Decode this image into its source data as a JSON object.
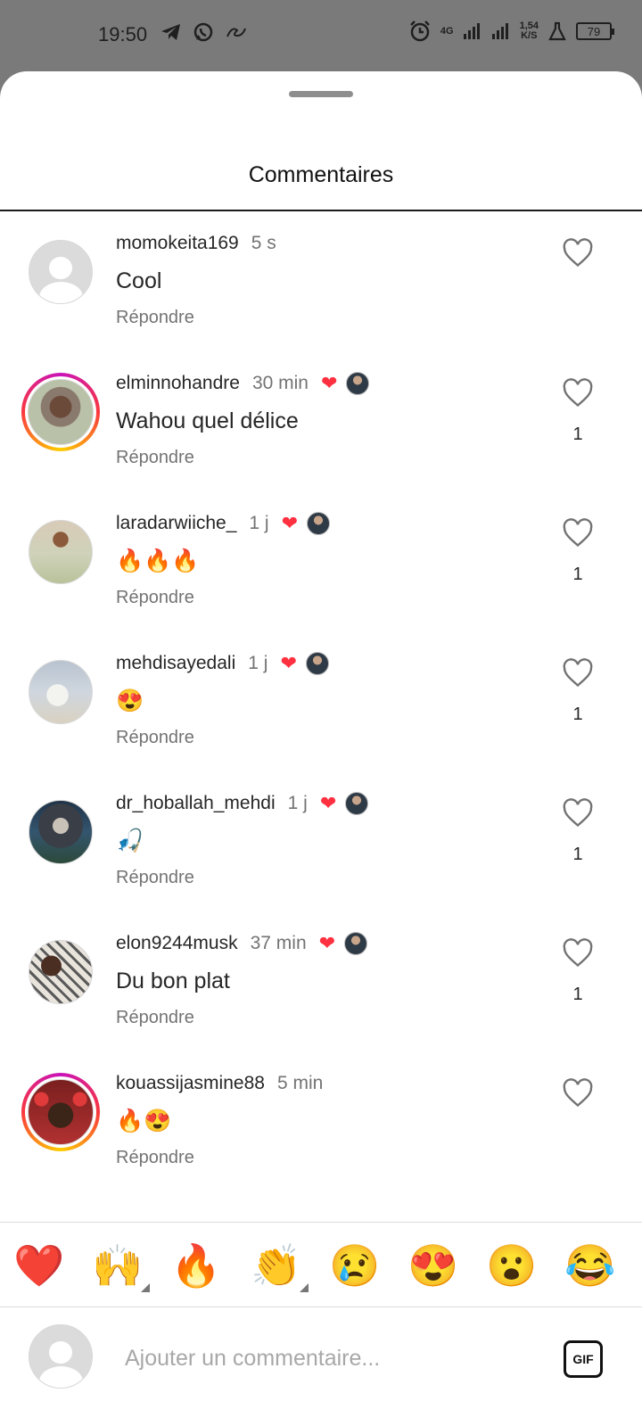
{
  "status_bar": {
    "time": "19:50",
    "network": "4G",
    "speed_value": "1,54",
    "speed_unit": "K/S",
    "battery": "79",
    "icons": [
      "telegram-icon",
      "whatsapp-icon",
      "link-icon",
      "alarm-icon",
      "signal-icon",
      "signal-icon",
      "lab-icon",
      "battery-icon"
    ]
  },
  "sheet": {
    "title": "Commentaires"
  },
  "comments": [
    {
      "username": "momokeita169",
      "time": "5 s",
      "text": "Cool",
      "reply": "Répondre",
      "liked_by_author": false,
      "likes": "",
      "story": false,
      "avatar": "default"
    },
    {
      "username": "elminnohandre",
      "time": "30 min",
      "text": "Wahou quel délice",
      "reply": "Répondre",
      "liked_by_author": true,
      "likes": "1",
      "story": true,
      "avatar": "photo-man"
    },
    {
      "username": "laradarwiiche_",
      "time": "1 j",
      "text": "🔥🔥🔥",
      "reply": "Répondre",
      "liked_by_author": true,
      "likes": "1",
      "story": false,
      "avatar": "photo-woman"
    },
    {
      "username": "mehdisayedali",
      "time": "1 j",
      "text": "😍",
      "reply": "Répondre",
      "liked_by_author": true,
      "likes": "1",
      "story": false,
      "avatar": "photo-couple"
    },
    {
      "username": "dr_hoballah_mehdi",
      "time": "1 j",
      "text": "🎣",
      "reply": "Répondre",
      "liked_by_author": true,
      "likes": "1",
      "story": false,
      "avatar": "photo-suit"
    },
    {
      "username": "elon9244musk",
      "time": "37 min",
      "text": "Du bon plat",
      "reply": "Répondre",
      "liked_by_author": true,
      "likes": "1",
      "story": false,
      "avatar": "photo-checked"
    },
    {
      "username": "kouassijasmine88",
      "time": "5 min",
      "text": "🔥😍",
      "reply": "Répondre",
      "liked_by_author": false,
      "likes": "",
      "story": true,
      "avatar": "photo-girl"
    }
  ],
  "emoji_bar": [
    "❤️",
    "🙌",
    "🔥",
    "👏",
    "😢",
    "😍",
    "😮",
    "😂"
  ],
  "input": {
    "placeholder": "Ajouter un commentaire...",
    "gif_label": "GIF"
  }
}
